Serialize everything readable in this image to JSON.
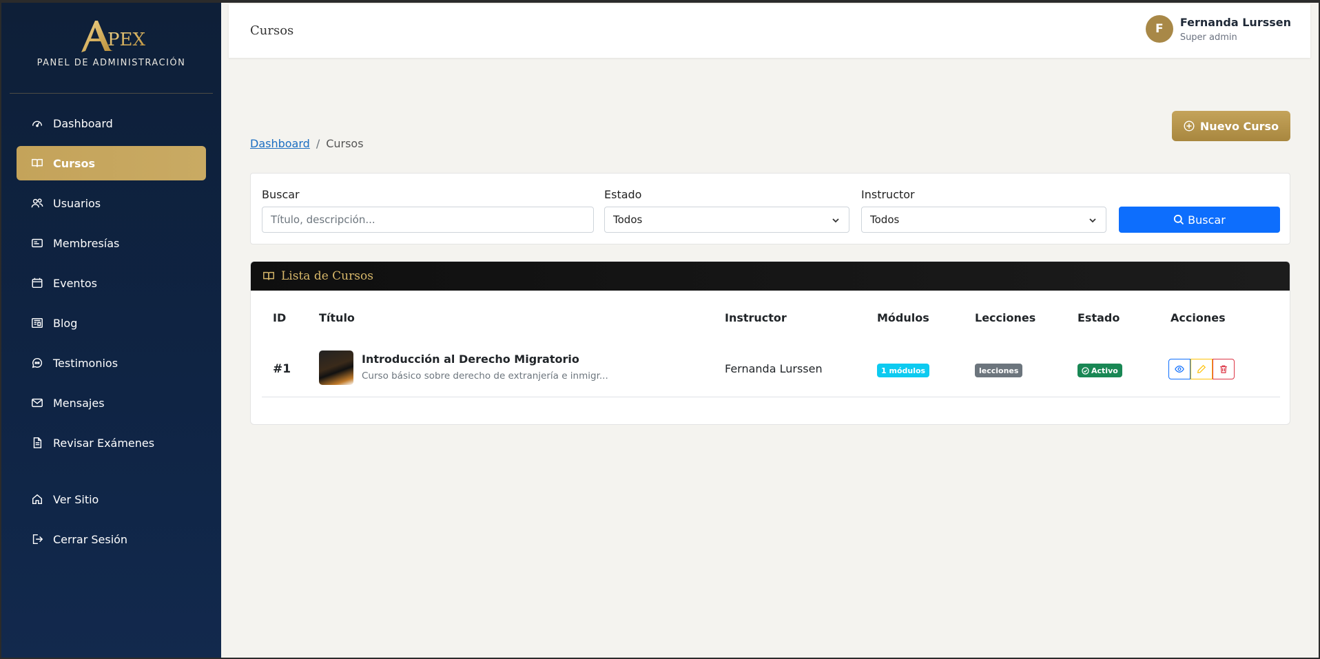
{
  "sidebar": {
    "brand_logo": "APEX",
    "brand_subtitle": "PANEL DE ADMINISTRACIÓN",
    "items": [
      {
        "label": "Dashboard",
        "icon": "gauge-icon",
        "active": false
      },
      {
        "label": "Cursos",
        "icon": "book-icon",
        "active": true
      },
      {
        "label": "Usuarios",
        "icon": "users-icon",
        "active": false
      },
      {
        "label": "Membresías",
        "icon": "card-icon",
        "active": false
      },
      {
        "label": "Eventos",
        "icon": "calendar-icon",
        "active": false
      },
      {
        "label": "Blog",
        "icon": "newspaper-icon",
        "active": false
      },
      {
        "label": "Testimonios",
        "icon": "quote-bubble-icon",
        "active": false
      },
      {
        "label": "Mensajes",
        "icon": "envelope-icon",
        "active": false
      },
      {
        "label": "Revisar Exámenes",
        "icon": "document-icon",
        "active": false
      }
    ],
    "footer_items": [
      {
        "label": "Ver Sitio",
        "icon": "house-icon"
      },
      {
        "label": "Cerrar Sesión",
        "icon": "logout-icon"
      }
    ]
  },
  "topbar": {
    "title": "Cursos",
    "user": {
      "initial": "F",
      "name": "Fernanda Lurssen",
      "role": "Super admin"
    }
  },
  "new_course_button": "Nuevo Curso",
  "breadcrumb": {
    "home": "Dashboard",
    "current": "Cursos"
  },
  "filters": {
    "search_label": "Buscar",
    "search_placeholder": "Título, descripción...",
    "estado_label": "Estado",
    "estado_value": "Todos",
    "instructor_label": "Instructor",
    "instructor_value": "Todos",
    "search_button": "Buscar"
  },
  "courses_card": {
    "title": "Lista de Cursos",
    "columns": [
      "ID",
      "Título",
      "Instructor",
      "Módulos",
      "Lecciones",
      "Estado",
      "Acciones"
    ],
    "rows": [
      {
        "id": "#1",
        "title": "Introducción al Derecho Migratorio",
        "description": "Curso básico sobre derecho de extranjería e inmigr...",
        "instructor": "Fernanda Lurssen",
        "modules": "1 módulos",
        "lessons": "lecciones",
        "status": "Activo"
      }
    ]
  },
  "colors": {
    "sidebar_bg": "#0f2444",
    "gold_accent": "#c4a35a",
    "primary_blue": "#0d6efd",
    "badge_info": "#0dcaf0",
    "badge_secondary": "#6c757d",
    "badge_success": "#198754"
  }
}
